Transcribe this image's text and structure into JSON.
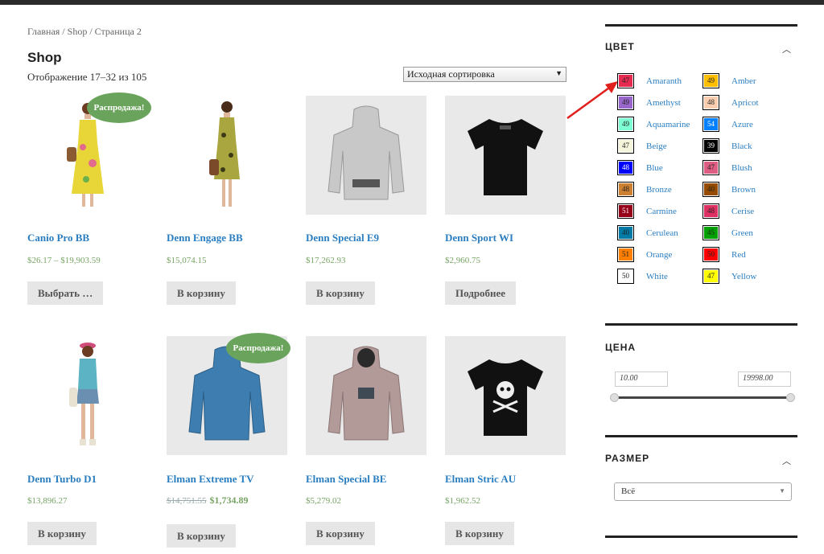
{
  "breadcrumb": {
    "home": "Главная",
    "sep": " / ",
    "shop": "Shop",
    "page": "Страница 2"
  },
  "page_title": "Shop",
  "result_count": "Отображение 17–32 из 105",
  "ordering": {
    "selected": "Исходная сортировка"
  },
  "sale_label": "Распродажа!",
  "products": [
    {
      "title": "Canio Pro BB",
      "price": "$26.17 – $19,903.59",
      "button": "Выбрать …",
      "image": "dress-model-yellow",
      "sale": true
    },
    {
      "title": "Denn Engage BB",
      "price": "$15,074.15",
      "button": "В корзину",
      "image": "dress-model-floral",
      "sale": false
    },
    {
      "title": "Denn Special E9",
      "price": "$17,262.93",
      "button": "В корзину",
      "image": "hoodie-grey-back",
      "sale": false
    },
    {
      "title": "Denn Sport WI",
      "price": "$2,960.75",
      "button": "Подробнее",
      "image": "tshirt-black",
      "sale": false
    },
    {
      "title": "Denn Turbo D1",
      "price": "$13,896.27",
      "button": "В корзину",
      "image": "model-denim",
      "sale": false
    },
    {
      "title": "Elman Extreme TV",
      "price_old": "$14,751.55",
      "price_new": "$1,734.89",
      "button": "В корзину",
      "image": "hoodie-blue-back",
      "sale": true
    },
    {
      "title": "Elman Special BE",
      "price": "$5,279.02",
      "button": "В корзину",
      "image": "hoodie-mauve-front",
      "sale": false
    },
    {
      "title": "Elman Stric AU",
      "price": "$1,962.52",
      "button": "В корзину",
      "image": "tshirt-black-skull",
      "sale": false
    }
  ],
  "sidebar": {
    "color_title": "ЦВЕТ",
    "price_title": "ЦЕНА",
    "size_title": "РАЗМЕР",
    "price_min": "10.00",
    "price_max": "19998.00",
    "size_selected": "Всё",
    "colors": [
      {
        "name": "Amaranth",
        "count": "47",
        "hex": "#e52b50"
      },
      {
        "name": "Amber",
        "count": "49",
        "hex": "#ffbf00"
      },
      {
        "name": "Amethyst",
        "count": "49",
        "hex": "#9966cc"
      },
      {
        "name": "Apricot",
        "count": "48",
        "hex": "#fbceb1"
      },
      {
        "name": "Aquamarine",
        "count": "49",
        "hex": "#7fffd4"
      },
      {
        "name": "Azure",
        "count": "54",
        "hex": "#007fff"
      },
      {
        "name": "Beige",
        "count": "47",
        "hex": "#f5f5dc"
      },
      {
        "name": "Black",
        "count": "39",
        "hex": "#000000"
      },
      {
        "name": "Blue",
        "count": "48",
        "hex": "#0000ff"
      },
      {
        "name": "Blush",
        "count": "47",
        "hex": "#de5d83"
      },
      {
        "name": "Bronze",
        "count": "48",
        "hex": "#cd7f32"
      },
      {
        "name": "Brown",
        "count": "40",
        "hex": "#964b00"
      },
      {
        "name": "Carmine",
        "count": "51",
        "hex": "#960018"
      },
      {
        "name": "Cerise",
        "count": "48",
        "hex": "#de3163"
      },
      {
        "name": "Cerulean",
        "count": "40",
        "hex": "#007ba7"
      },
      {
        "name": "Green",
        "count": "45",
        "hex": "#00a000"
      },
      {
        "name": "Orange",
        "count": "51",
        "hex": "#ff7f00"
      },
      {
        "name": "Red",
        "count": "50",
        "hex": "#ff0000"
      },
      {
        "name": "White",
        "count": "50",
        "hex": "#ffffff"
      },
      {
        "name": "Yellow",
        "count": "47",
        "hex": "#ffff00"
      }
    ]
  },
  "colors": {
    "link": "#2a7ec0",
    "price": "#77a464",
    "sale_badge": "#6aa45c",
    "annotation_arrow": "#e0201c"
  }
}
